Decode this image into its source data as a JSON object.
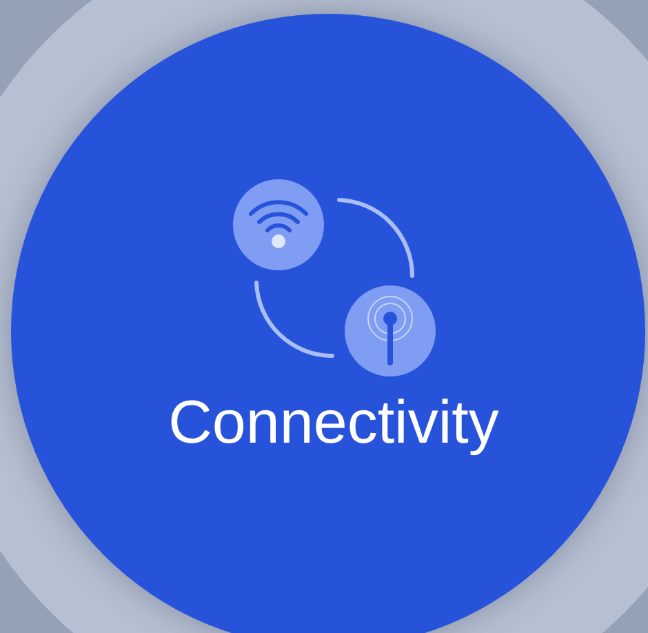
{
  "title": "Connectivity"
}
